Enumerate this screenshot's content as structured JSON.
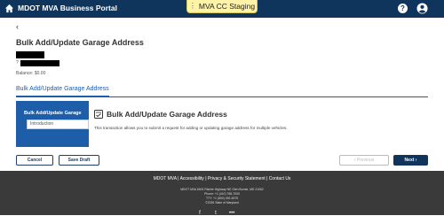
{
  "header": {
    "title": "MDOT MVA Business Portal",
    "environment": "MVA CC Staging",
    "help_label": "?"
  },
  "page": {
    "back_label": "‹",
    "title": "Bulk Add/Update Garage Address",
    "account_prefix": "?",
    "balance": "Balance: $0.00"
  },
  "tabs": [
    {
      "label": "Bulk Add/Update Garage Address"
    }
  ],
  "steps": {
    "heading": "Bulk Add/Update Garage",
    "items": [
      "Introduction"
    ]
  },
  "section": {
    "title": "Bulk Add/Update Garage Address",
    "description": "This transaction allows you to submit a request for adding or updating garage address for multiple vehicles."
  },
  "buttons": {
    "cancel": "Cancel",
    "save_draft": "Save Draft",
    "previous": "‹  Previous",
    "next": "Next  ›"
  },
  "footer": {
    "links": "MDOT MVA | Accessibility | Privacy & Security Statement | Contact Us",
    "address": "MDOT MVA 6601 Ritchie Highway NE Glen Burnie, MD 21062",
    "phone": "Phone: +1 (410) 768-7000",
    "tty": "TTY: +1 (800) 492-4575",
    "copyright": "©2026 State of Maryland"
  },
  "colors": {
    "navy": "#10355c",
    "accent_blue": "#1e5ea8",
    "footer_bg": "#3a3a3a",
    "env_badge": "#fff3a8"
  }
}
